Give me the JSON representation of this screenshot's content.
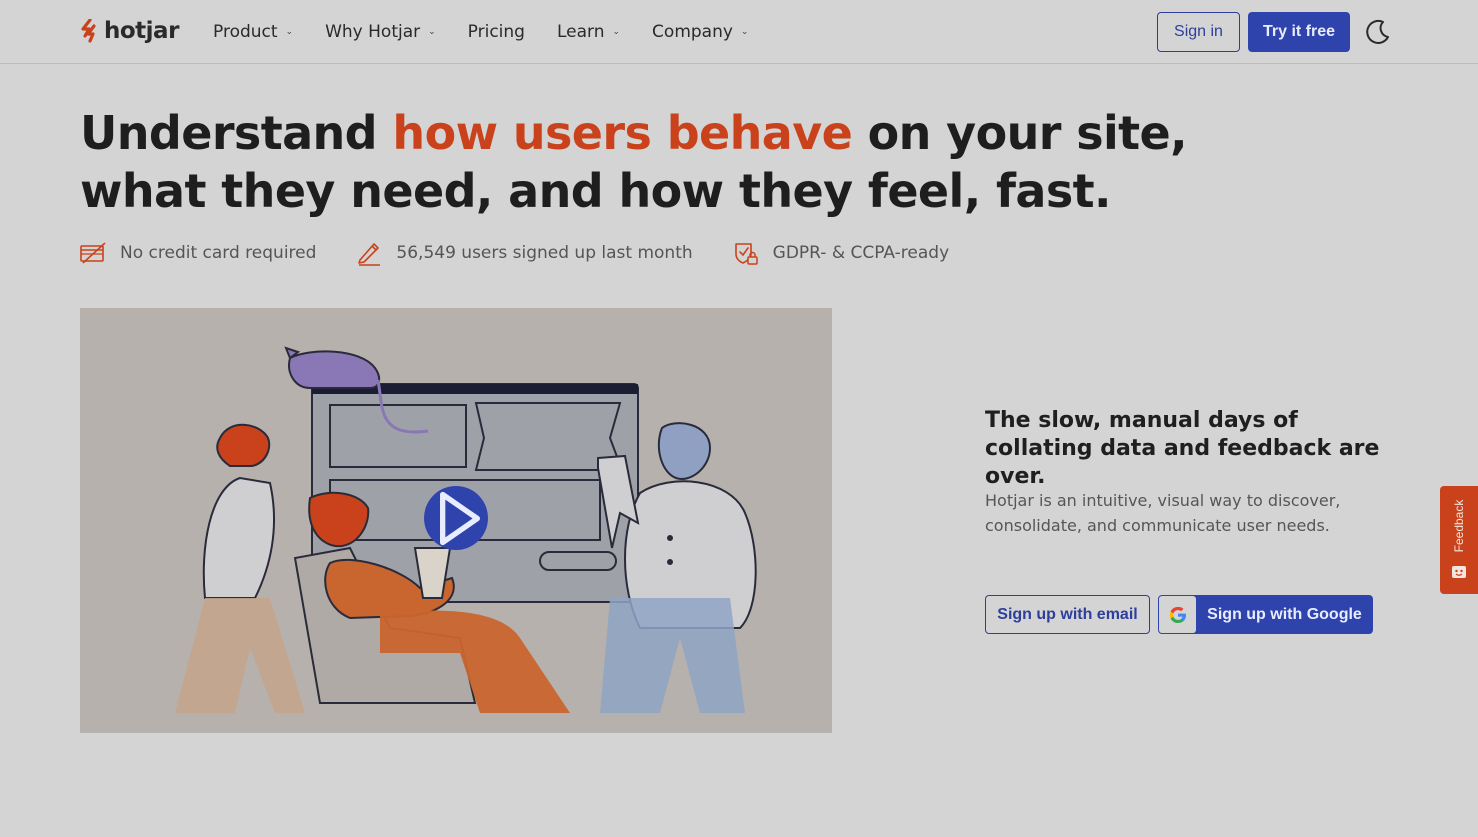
{
  "brand": {
    "name": "hotjar",
    "accent": "#c9421b",
    "primary": "#2f43ad"
  },
  "nav": {
    "items": [
      {
        "label": "Product",
        "dropdown": true
      },
      {
        "label": "Why Hotjar",
        "dropdown": true
      },
      {
        "label": "Pricing",
        "dropdown": false
      },
      {
        "label": "Learn",
        "dropdown": true
      },
      {
        "label": "Company",
        "dropdown": true
      }
    ],
    "caret": "⌄",
    "sign_in": "Sign in",
    "try_free": "Try it free",
    "theme_icon": "moon-icon"
  },
  "hero": {
    "headline_pre": "Understand ",
    "headline_accent": "how users behave",
    "headline_post": " on your site, what they need, and how they feel, fast.",
    "badges": [
      {
        "icon": "credit-card-icon",
        "text": "No credit card required"
      },
      {
        "icon": "pencil-icon",
        "text": "56,549 users signed up last month"
      },
      {
        "icon": "shield-lock-icon",
        "text": "GDPR- & CCPA-ready"
      }
    ]
  },
  "media": {
    "play_icon": "play-icon"
  },
  "signup": {
    "subhead": "The slow, manual days of collating data and feedback are over.",
    "description": "Hotjar is an intuitive, visual way to discover, consolidate, and communicate user needs.",
    "email_button": "Sign up with email",
    "google_button": "Sign up with Google"
  },
  "feedback_tab": {
    "label": "Feedback"
  }
}
